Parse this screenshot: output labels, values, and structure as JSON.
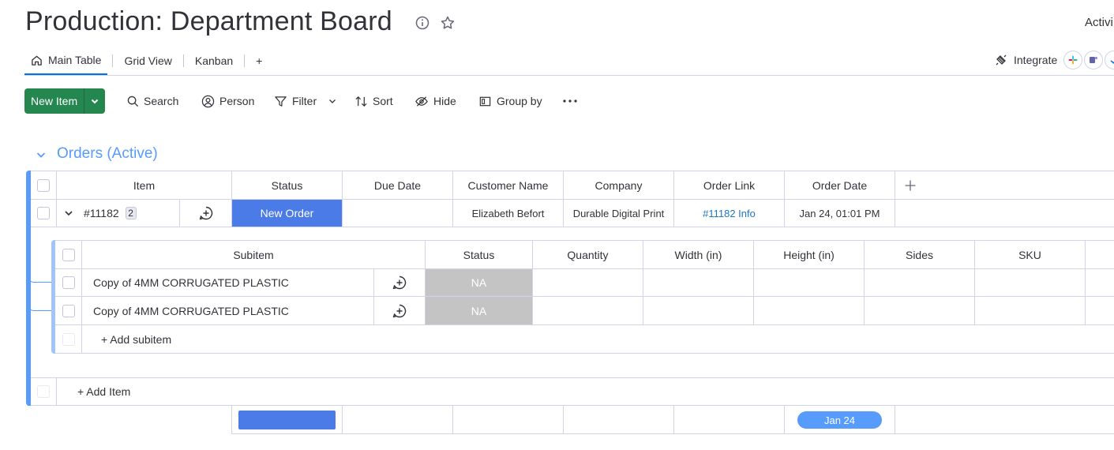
{
  "header": {
    "title": "Production: Department Board",
    "activity_label": "Activi"
  },
  "tabs": [
    {
      "label": "Main Table",
      "icon": "home-icon",
      "active": true
    },
    {
      "label": "Grid View"
    },
    {
      "label": "Kanban"
    },
    {
      "label": "+"
    }
  ],
  "integrate": {
    "label": "Integrate"
  },
  "toolbar": {
    "new_item": "New Item",
    "search": "Search",
    "person": "Person",
    "filter": "Filter",
    "sort": "Sort",
    "hide": "Hide",
    "group_by": "Group by"
  },
  "group": {
    "title": "Orders (Active)",
    "color": "#579bfc",
    "columns": [
      "Item",
      "Status",
      "Due Date",
      "Customer Name",
      "Company",
      "Order Link",
      "Order Date"
    ],
    "items": [
      {
        "id": "#11182",
        "subitem_count": "2",
        "status": "New Order",
        "status_color": "#4a7be6",
        "due_date": "",
        "customer_name": "Elizabeth Befort",
        "company": "Durable Digital Print",
        "order_link": "#11182 Info",
        "order_date": "Jan 24, 01:01 PM"
      }
    ],
    "add_item": "+ Add Item",
    "summary_date": "Jan 24"
  },
  "subitems": {
    "columns": [
      "Subitem",
      "Status",
      "Quantity",
      "Width (in)",
      "Height (in)",
      "Sides",
      "SKU"
    ],
    "rows": [
      {
        "name": "Copy of 4MM CORRUGATED PLASTIC",
        "status": "NA"
      },
      {
        "name": "Copy of 4MM CORRUGATED PLASTIC",
        "status": "NA"
      }
    ],
    "add_subitem": "+ Add subitem"
  }
}
